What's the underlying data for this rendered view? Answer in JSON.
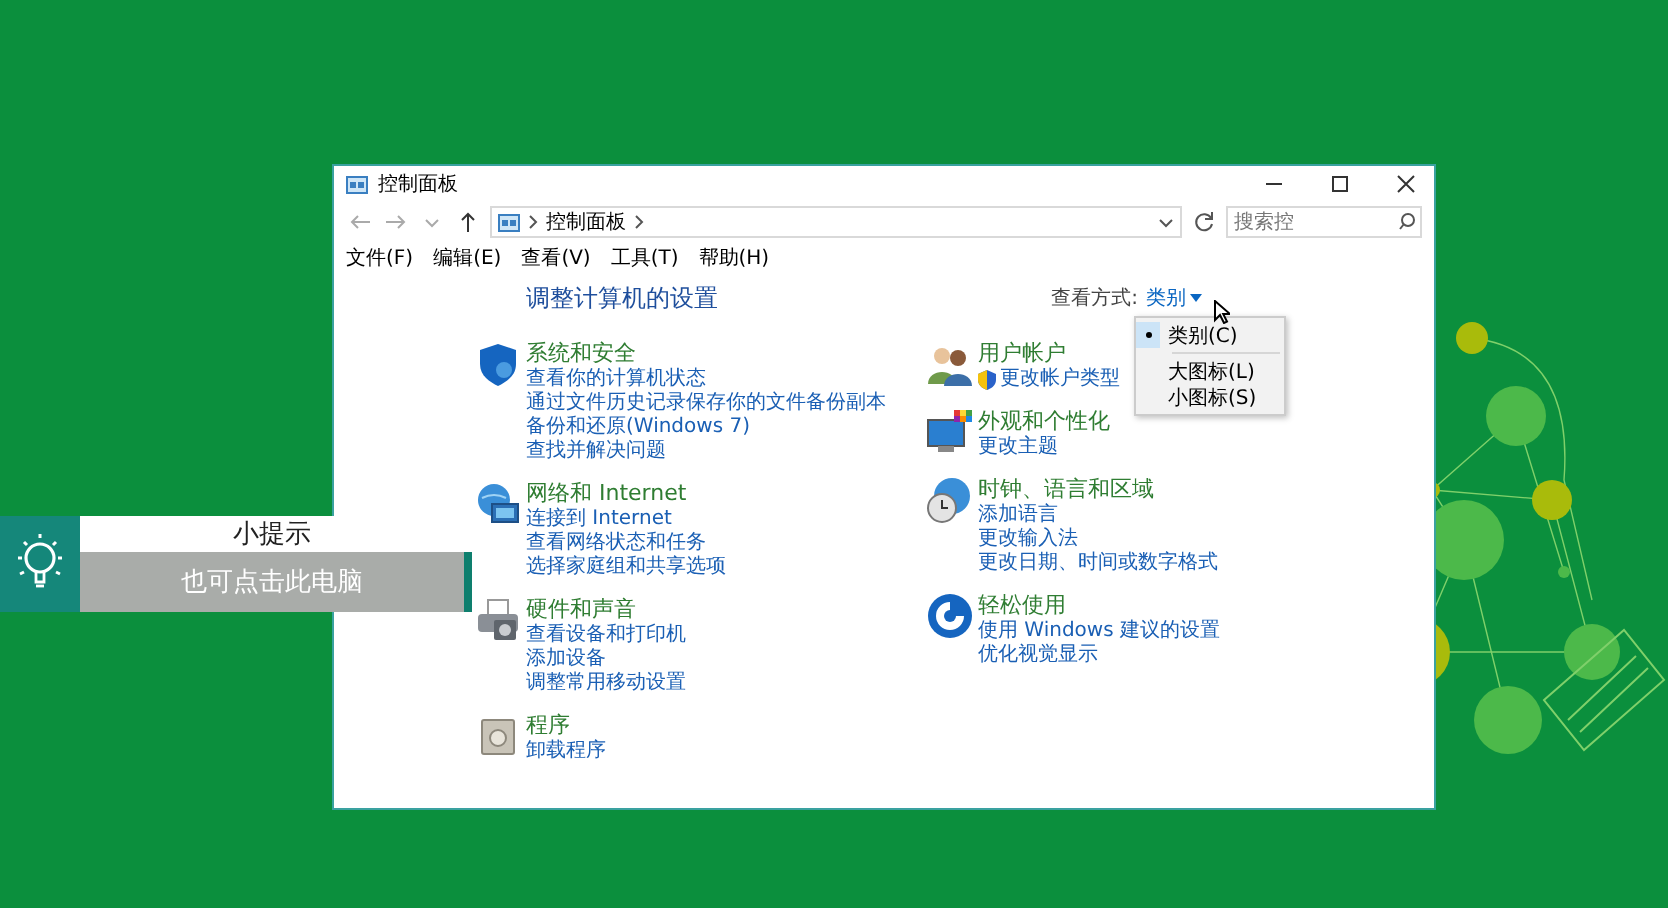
{
  "window": {
    "title": "控制面板"
  },
  "address_bar": {
    "path": [
      "控制面板"
    ]
  },
  "search": {
    "placeholder": "搜索控"
  },
  "menu_bar": [
    "文件(F)",
    "编辑(E)",
    "查看(V)",
    "工具(T)",
    "帮助(H)"
  ],
  "heading": "调整计算机的设置",
  "view_by": {
    "label": "查看方式:",
    "value": "类别"
  },
  "view_menu": [
    {
      "label": "类别(C)",
      "selected": true
    },
    {
      "label": "大图标(L)",
      "selected": false
    },
    {
      "label": "小图标(S)",
      "selected": false
    }
  ],
  "columns": [
    [
      {
        "kind": "security",
        "title": "系统和安全",
        "links": [
          {
            "text": "查看你的计算机状态",
            "shield": false
          },
          {
            "text": "通过文件历史记录保存你的文件备份副本",
            "shield": false
          },
          {
            "text": "备份和还原(Windows 7)",
            "shield": false
          },
          {
            "text": "查找并解决问题",
            "shield": false
          }
        ]
      },
      {
        "kind": "network",
        "title": "网络和 Internet",
        "links": [
          {
            "text": "连接到 Internet",
            "shield": false
          },
          {
            "text": "查看网络状态和任务",
            "shield": false
          },
          {
            "text": "选择家庭组和共享选项",
            "shield": false
          }
        ]
      },
      {
        "kind": "hardware",
        "title": "硬件和声音",
        "links": [
          {
            "text": "查看设备和打印机",
            "shield": false
          },
          {
            "text": "添加设备",
            "shield": false
          },
          {
            "text": "调整常用移动设置",
            "shield": false
          }
        ]
      },
      {
        "kind": "programs",
        "title": "程序",
        "links": [
          {
            "text": "卸载程序",
            "shield": false
          }
        ]
      }
    ],
    [
      {
        "kind": "users",
        "title": "用户帐户",
        "links": [
          {
            "text": "更改帐户类型",
            "shield": true
          }
        ]
      },
      {
        "kind": "appearance",
        "title": "外观和个性化",
        "links": [
          {
            "text": "更改主题",
            "shield": false
          }
        ]
      },
      {
        "kind": "clock",
        "title": "时钟、语言和区域",
        "links": [
          {
            "text": "添加语言",
            "shield": false
          },
          {
            "text": "更改输入法",
            "shield": false
          },
          {
            "text": "更改日期、时间或数字格式",
            "shield": false
          }
        ]
      },
      {
        "kind": "ease",
        "title": "轻松使用",
        "links": [
          {
            "text": "使用 Windows 建议的设置",
            "shield": false
          },
          {
            "text": "优化视觉显示",
            "shield": false
          }
        ]
      }
    ]
  ],
  "tip": {
    "title": "小提示",
    "text": "也可点击此电脑"
  }
}
